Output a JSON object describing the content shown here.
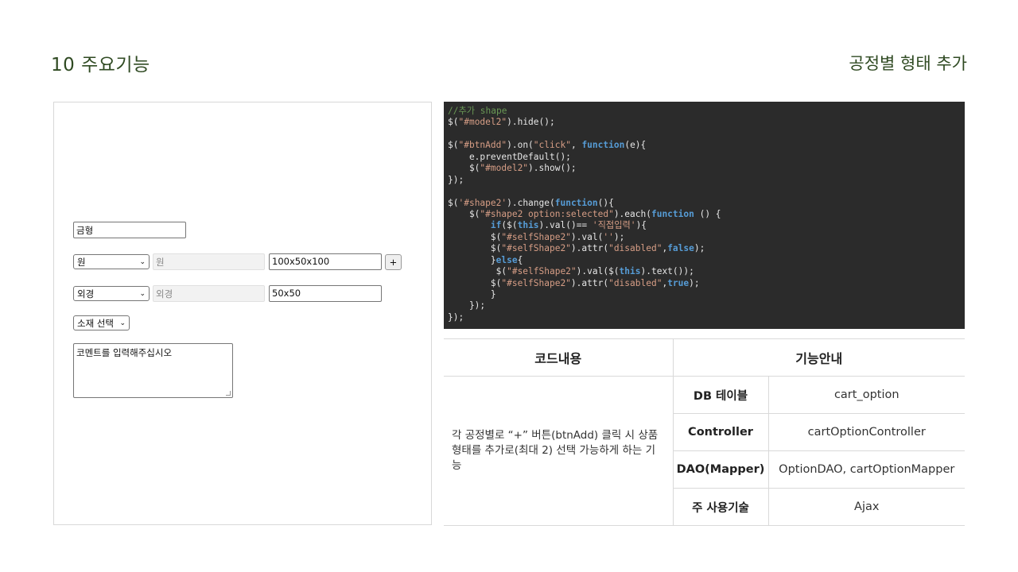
{
  "slide": {
    "title": "10 주요기능",
    "subtitle": "공정별 형태 추가"
  },
  "demo": {
    "mold_input": "금형",
    "shape_row1": {
      "select": "원",
      "input_disabled": "원",
      "input_size": "100x50x100",
      "add_button": "+"
    },
    "shape_row2": {
      "select": "외경",
      "input_disabled": "외경",
      "input_size": "50x50"
    },
    "material_select": "소재 선택",
    "comment_placeholder": "코멘트를 입력해주십시오"
  },
  "code": [
    [
      [
        "c-com",
        "//추가 shape"
      ]
    ],
    [
      [
        "",
        "$("
      ],
      [
        "c-str",
        "\"#model2\""
      ],
      [
        "",
        ").hide();"
      ]
    ],
    [
      [
        "",
        ""
      ]
    ],
    [
      [
        "",
        "$("
      ],
      [
        "c-str",
        "\"#btnAdd\""
      ],
      [
        "",
        ").on("
      ],
      [
        "c-str",
        "\"click\""
      ],
      [
        "",
        ", "
      ],
      [
        "c-kw",
        "function"
      ],
      [
        "",
        "(e){"
      ]
    ],
    [
      [
        "",
        "    e.preventDefault();"
      ]
    ],
    [
      [
        "",
        "    $("
      ],
      [
        "c-str",
        "\"#model2\""
      ],
      [
        "",
        ").show();"
      ]
    ],
    [
      [
        "",
        "});"
      ]
    ],
    [
      [
        "",
        ""
      ]
    ],
    [
      [
        "",
        "$("
      ],
      [
        "c-str",
        "'#shape2'"
      ],
      [
        "",
        ").change("
      ],
      [
        "c-kw",
        "function"
      ],
      [
        "",
        "(){"
      ]
    ],
    [
      [
        "",
        "    $("
      ],
      [
        "c-str",
        "\"#shape2 option:selected\""
      ],
      [
        "",
        ").each("
      ],
      [
        "c-kw",
        "function"
      ],
      [
        "",
        " () {"
      ]
    ],
    [
      [
        "",
        "        "
      ],
      [
        "c-kw",
        "if"
      ],
      [
        "",
        "($("
      ],
      [
        "c-kw",
        "this"
      ],
      [
        "",
        ").val()== "
      ],
      [
        "c-str",
        "'직접입력'"
      ],
      [
        "",
        "){"
      ]
    ],
    [
      [
        "",
        "        $("
      ],
      [
        "c-str",
        "\"#selfShape2\""
      ],
      [
        "",
        ").val("
      ],
      [
        "c-str",
        "''"
      ],
      [
        "",
        ");"
      ]
    ],
    [
      [
        "",
        "        $("
      ],
      [
        "c-str",
        "\"#selfShape2\""
      ],
      [
        "",
        ").attr("
      ],
      [
        "c-str",
        "\"disabled\""
      ],
      [
        "",
        ","
      ],
      [
        "c-kw",
        "false"
      ],
      [
        "",
        ");"
      ]
    ],
    [
      [
        "",
        "        }"
      ],
      [
        "c-kw",
        "else"
      ],
      [
        "",
        "{"
      ]
    ],
    [
      [
        "",
        "         $("
      ],
      [
        "c-str",
        "\"#selfShape2\""
      ],
      [
        "",
        ").val($("
      ],
      [
        "c-kw",
        "this"
      ],
      [
        "",
        ").text());"
      ]
    ],
    [
      [
        "",
        "        $("
      ],
      [
        "c-str",
        "\"#selfShape2\""
      ],
      [
        "",
        ").attr("
      ],
      [
        "c-str",
        "\"disabled\""
      ],
      [
        "",
        ","
      ],
      [
        "c-kw",
        "true"
      ],
      [
        "",
        ");"
      ]
    ],
    [
      [
        "",
        "        }"
      ]
    ],
    [
      [
        "",
        "    });"
      ]
    ],
    [
      [
        "",
        "});"
      ]
    ]
  ],
  "table": {
    "header_code": "코드내용",
    "header_func": "기능안내",
    "description": "각 공정별로 “+” 버튼(btnAdd) 클릭 시 상품 형태를 추가로(최대 2) 선택 가능하게 하는 기능",
    "rows": [
      {
        "key": "DB 테이블",
        "value": "cart_option"
      },
      {
        "key": "Controller",
        "value": "cartOptionController"
      },
      {
        "key": "DAO(Mapper)",
        "value": "OptionDAO, cartOptionMapper"
      },
      {
        "key": "주 사용기술",
        "value": "Ajax"
      }
    ]
  }
}
